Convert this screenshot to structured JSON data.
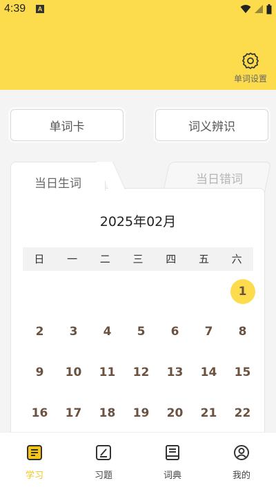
{
  "status_bar": {
    "time": "4:39",
    "badge": "A"
  },
  "header": {
    "settings_label": "单词设置",
    "background": "#fcdc4d"
  },
  "actions": {
    "cards_label": "单词卡",
    "meaning_label": "词义辨识"
  },
  "tabs": {
    "active_label": "当日生词",
    "inactive_label": "当日错词"
  },
  "calendar": {
    "month_title": "2025年02月",
    "weekdays": [
      "日",
      "一",
      "二",
      "三",
      "四",
      "五",
      "六"
    ],
    "selected_day": "1",
    "rows": [
      [
        "",
        "",
        "",
        "",
        "",
        "",
        "1"
      ],
      [
        "2",
        "3",
        "4",
        "5",
        "6",
        "7",
        "8"
      ],
      [
        "9",
        "10",
        "11",
        "12",
        "13",
        "14",
        "15"
      ],
      [
        "16",
        "17",
        "18",
        "19",
        "20",
        "21",
        "22"
      ]
    ]
  },
  "bottom_nav": {
    "items": [
      {
        "label": "学习",
        "icon": "study-icon",
        "active": true
      },
      {
        "label": "习题",
        "icon": "exercise-icon",
        "active": false
      },
      {
        "label": "词典",
        "icon": "dictionary-icon",
        "active": false
      },
      {
        "label": "我的",
        "icon": "profile-icon",
        "active": false
      }
    ]
  },
  "colors": {
    "accent": "#fcdc4d",
    "day_text": "#6b5240",
    "active_nav": "#f5c518"
  }
}
